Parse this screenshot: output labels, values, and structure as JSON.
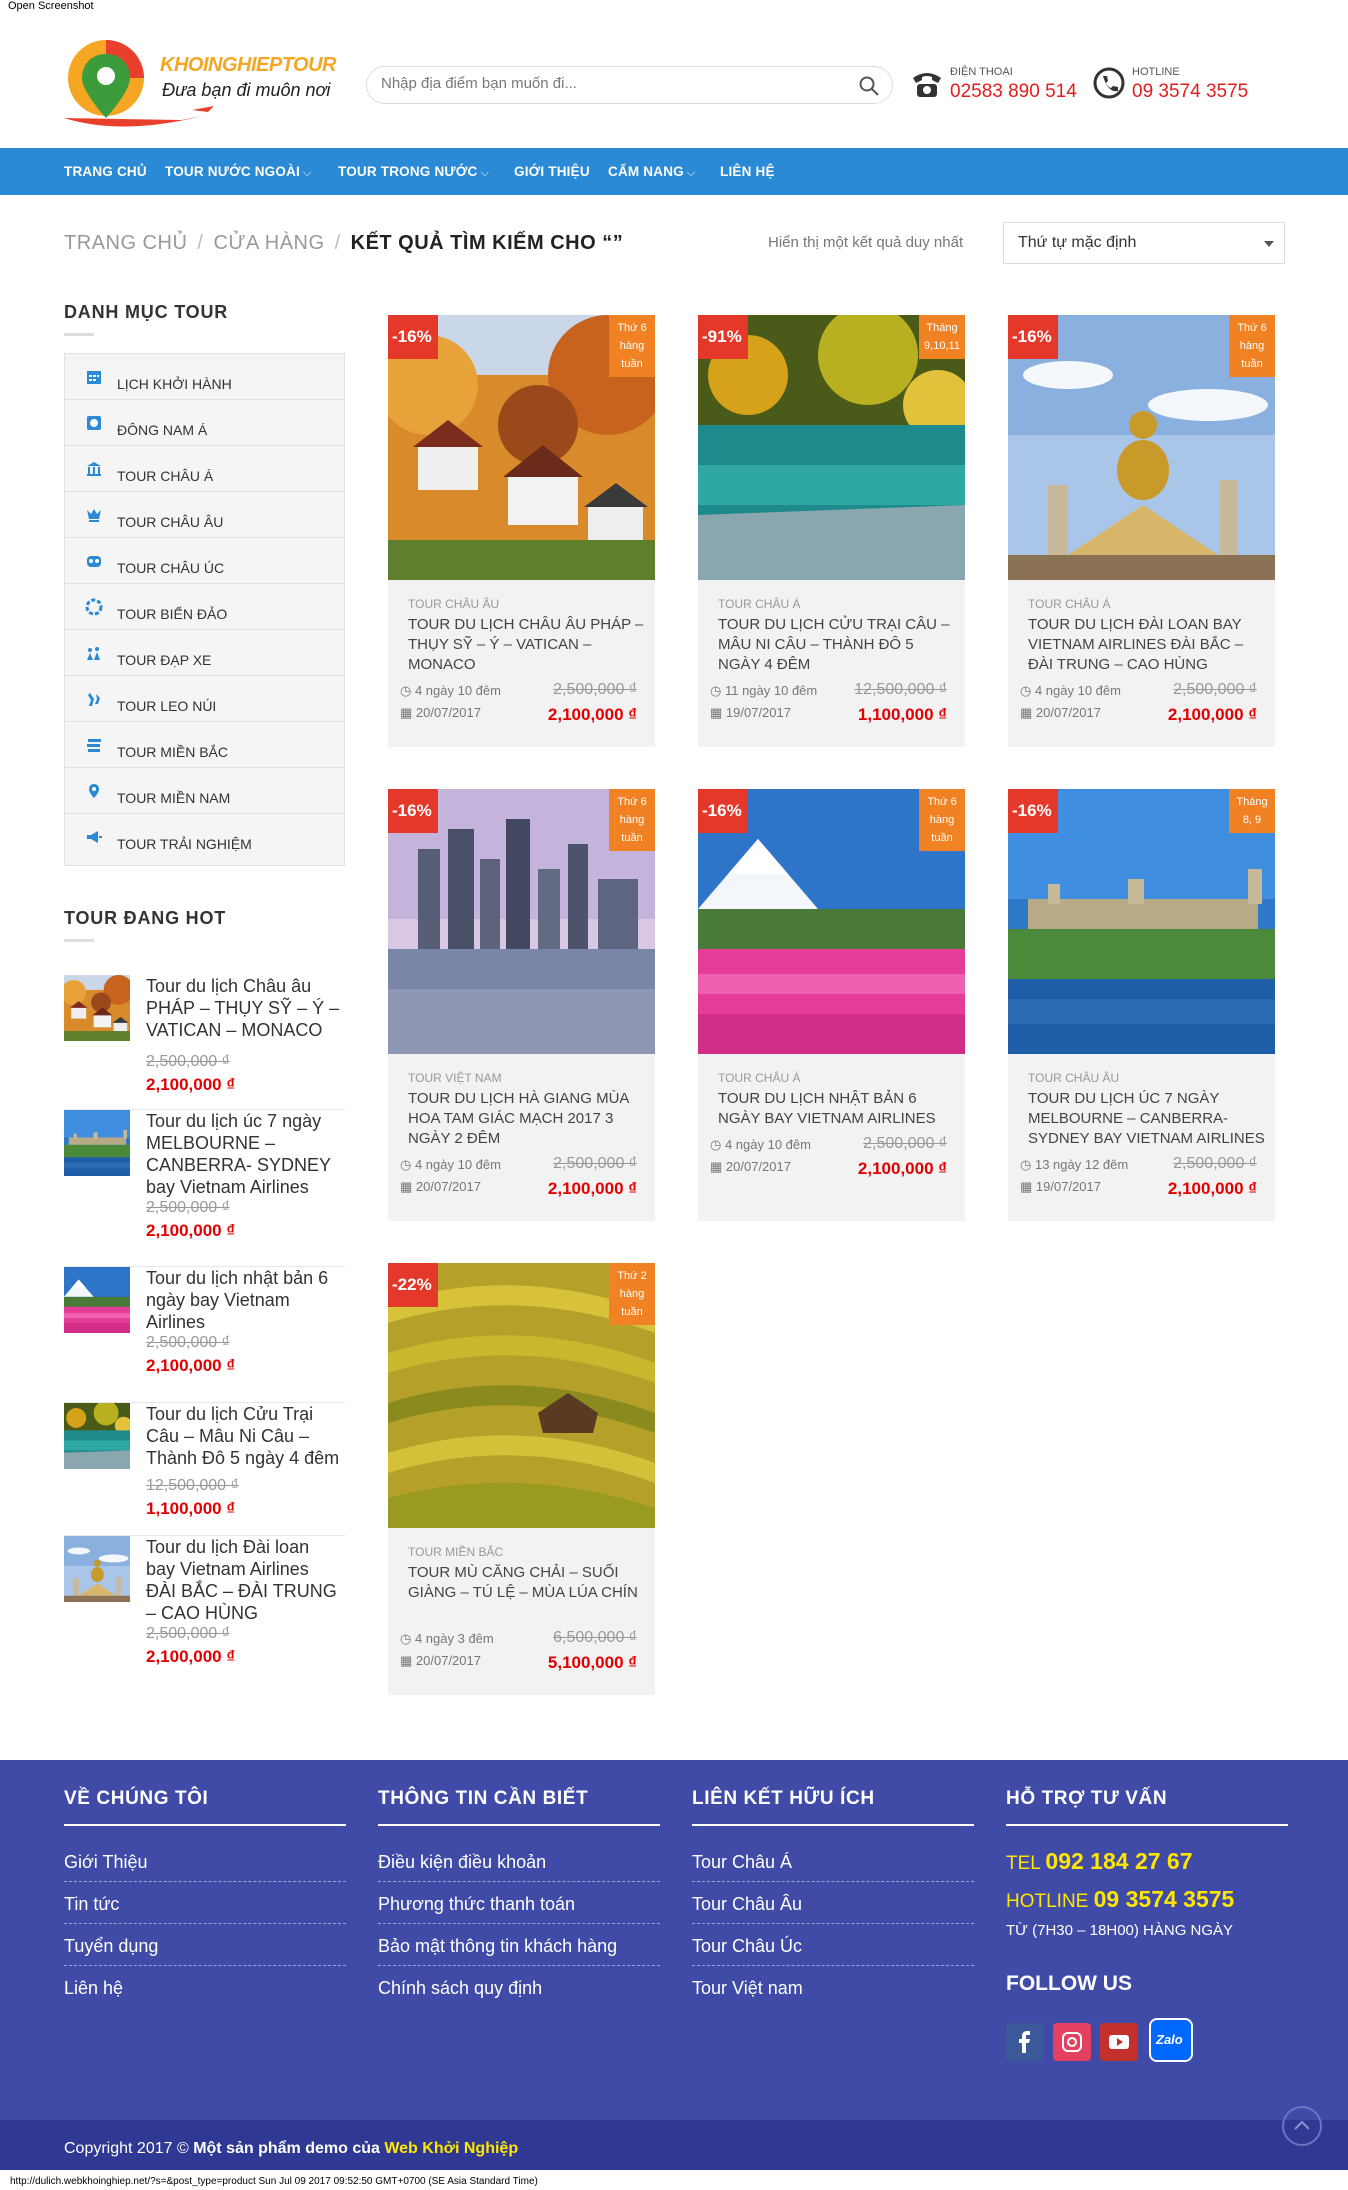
{
  "browser": {
    "title": "Open Screenshot",
    "status_url": "http://dulich.webkhoinghiep.net/?s=&post_type=product Sun Jul 09 2017 09:52:50 GMT+0700 (SE Asia Standard Time)"
  },
  "header": {
    "logo_text": "KHOINGHIEPTOUR",
    "logo_slogan": "Đưa bạn đi muôn nơi",
    "search_placeholder": "Nhập địa điểm bạn muốn đi...",
    "phone_label": "ĐIỆN THOẠI",
    "phone_value": "02583 890 514",
    "hotline_label": "HOTLINE",
    "hotline_value": "09 3574 3575"
  },
  "nav": [
    "TRANG CHỦ",
    "TOUR NƯỚC NGOÀI",
    "TOUR TRONG NƯỚC",
    "GIỚI THIỆU",
    "CẨM NANG",
    "LIÊN HỆ"
  ],
  "nav_caret": "⌵",
  "breadcrumb": {
    "home": "TRANG CHỦ",
    "shop": "CỬA HÀNG",
    "current": "KẾT QUẢ TÌM KIẾM CHO “”",
    "sep": "/"
  },
  "result_text": "Hiển thị một kết quả duy nhất",
  "sort_selected": "Thứ tự mặc định",
  "sidebar": {
    "cat_title": "DANH MỤC TOUR",
    "categories": [
      "LỊCH KHỞI HÀNH",
      "ĐÔNG NAM Á",
      "TOUR CHÂU Á",
      "TOUR CHÂU ÂU",
      "TOUR CHÂU ÚC",
      "TOUR BIỂN ĐẢO",
      "TOUR ĐẠP XE",
      "TOUR LEO NÚI",
      "TOUR MIỀN BẮC",
      "TOUR MIỀN NAM",
      "TOUR TRẢI NGHIỆM"
    ],
    "hot_title": "TOUR ĐANG HOT",
    "hot": [
      {
        "name": "Tour du lịch Châu âu PHÁP – THỤY SỸ – Ý – VATICAN – MONACO",
        "old": "2,500,000 ₫",
        "new": "2,100,000 ₫"
      },
      {
        "name": "Tour du lịch úc 7 ngày MELBOURNE – CANBERRA- SYDNEY bay Vietnam Airlines",
        "old": "2,500,000 ₫",
        "new": "2,100,000 ₫"
      },
      {
        "name": "Tour du lịch nhật bản 6 ngày bay Vietnam Airlines",
        "old": "2,500,000 ₫",
        "new": "2,100,000 ₫"
      },
      {
        "name": "Tour du lịch Cửu Trại Câu – Mâu Ni Câu – Thành Đô 5 ngày 4 đêm",
        "old": "12,500,000 ₫",
        "new": "1,100,000 ₫"
      },
      {
        "name": "Tour du lịch Đài loan bay Vietnam Airlines ĐÀI BẮC – ĐÀI TRUNG – CAO HÙNG",
        "old": "2,500,000 ₫",
        "new": "2,100,000 ₫"
      }
    ]
  },
  "products": [
    {
      "discount": "-16%",
      "when": "Thứ 6 hàng tuần",
      "category": "TOUR CHÂU ÂU",
      "title": "TOUR DU LỊCH CHÂU ÂU PHÁP – THỤY SỸ – Ý – VATICAN – MONACO",
      "duration": "4 ngày 10 đêm",
      "date": "20/07/2017",
      "old": "2,500,000 ₫",
      "new": "2,100,000 ₫"
    },
    {
      "discount": "-91%",
      "when": "Tháng 9,10,11",
      "category": "TOUR CHÂU Á",
      "title": "TOUR DU LỊCH CỬU TRẠI CÂU – MÂU NI CÂU – THÀNH ĐÔ 5 NGÀY 4 ĐÊM",
      "duration": "11 ngày 10 đêm",
      "date": "19/07/2017",
      "old": "12,500,000 ₫",
      "new": "1,100,000 ₫"
    },
    {
      "discount": "-16%",
      "when": "Thứ 6 hàng tuần",
      "category": "TOUR CHÂU Á",
      "title": "TOUR DU LỊCH ĐÀI LOAN BAY VIETNAM AIRLINES ĐÀI BẮC – ĐÀI TRUNG – CAO HÙNG",
      "duration": "4 ngày 10 đêm",
      "date": "20/07/2017",
      "old": "2,500,000 ₫",
      "new": "2,100,000 ₫"
    },
    {
      "discount": "-16%",
      "when": "Thứ 6 hàng tuần",
      "category": "TOUR VIỆT NAM",
      "title": "TOUR DU LỊCH HÀ GIANG MÙA HOA TAM GIÁC MẠCH 2017 3 NGÀY 2 ĐÊM",
      "duration": "4 ngày 10 đêm",
      "date": "20/07/2017",
      "old": "2,500,000 ₫",
      "new": "2,100,000 ₫"
    },
    {
      "discount": "-16%",
      "when": "Thứ 6 hàng tuần",
      "category": "TOUR CHÂU Á",
      "title": "TOUR DU LỊCH NHẬT BẢN 6 NGÀY BAY VIETNAM AIRLINES",
      "duration": "4 ngày 10 đêm",
      "date": "20/07/2017",
      "old": "2,500,000 ₫",
      "new": "2,100,000 ₫"
    },
    {
      "discount": "-16%",
      "when": "Tháng 8, 9",
      "category": "TOUR CHÂU ÂU",
      "title": "TOUR DU LỊCH ÚC 7 NGÀY MELBOURNE – CANBERRA- SYDNEY BAY VIETNAM AIRLINES",
      "duration": "13 ngày 12 đêm",
      "date": "19/07/2017",
      "old": "2,500,000 ₫",
      "new": "2,100,000 ₫"
    },
    {
      "discount": "-22%",
      "when": "Thứ 2 hàng tuần",
      "category": "TOUR MIỀN BẮC",
      "title": "TOUR MÙ CĂNG CHẢI – SUỐI GIÀNG – TÚ LỆ – MÙA LÚA CHÍN",
      "duration": "4 ngày 3 đêm",
      "date": "20/07/2017",
      "old": "6,500,000 ₫",
      "new": "5,100,000 ₫"
    }
  ],
  "footer": {
    "about_title": "VỀ CHÚNG TÔI",
    "about_links": [
      "Giới Thiệu",
      "Tin tức",
      "Tuyển dụng",
      "Liên hệ"
    ],
    "info_title": "THÔNG TIN CẦN BIẾT",
    "info_links": [
      "Điều kiện điều khoản",
      "Phương thức thanh toán",
      "Bảo mật thông tin khách hàng",
      "Chính sách quy định"
    ],
    "links_title": "LIÊN KẾT HỮU ÍCH",
    "useful_links": [
      "Tour Châu Á",
      "Tour Châu Âu",
      "Tour Châu Úc",
      "Tour Việt nam"
    ],
    "support_title": "HỖ TRỢ TƯ VẤN",
    "tel_label": "TEL",
    "tel_value": "092 184 27 67",
    "hotline_label": "HOTLINE",
    "hotline_value": "09 3574 3575",
    "hours": "TỪ (7H30 – 18H00) HÀNG NGÀY",
    "follow_title": "FOLLOW US",
    "zalo": "Zalo",
    "copyright_pre": "Copyright 2017 © ",
    "copyright_mid": "Một sản phẩm demo của ",
    "copyright_brand": "Web Khởi Nghiệp"
  },
  "colors": {
    "nav": "#2b8ad6",
    "discount": "#e4392a",
    "badge": "#f08224",
    "price": "#e30000",
    "footer": "#3f4ba6"
  }
}
